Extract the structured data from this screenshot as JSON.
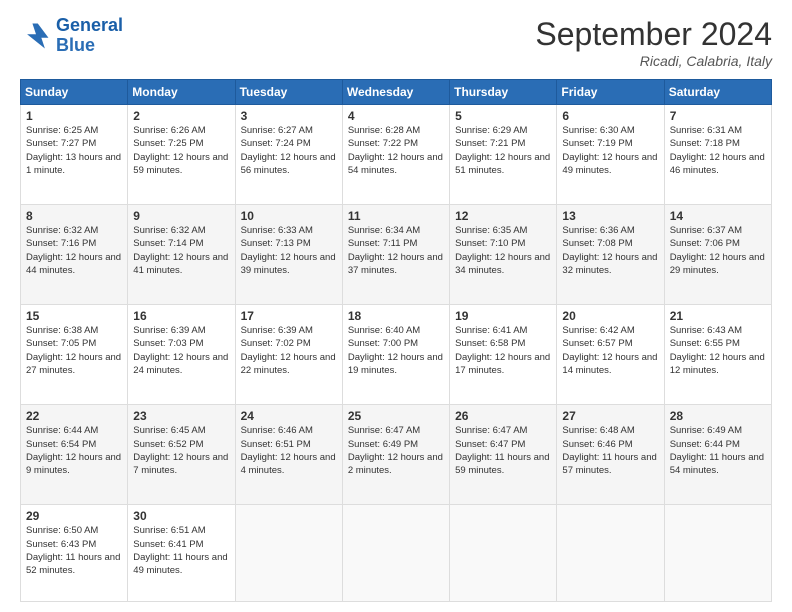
{
  "header": {
    "logo_line1": "General",
    "logo_line2": "Blue",
    "month": "September 2024",
    "location": "Ricadi, Calabria, Italy"
  },
  "days_of_week": [
    "Sunday",
    "Monday",
    "Tuesday",
    "Wednesday",
    "Thursday",
    "Friday",
    "Saturday"
  ],
  "weeks": [
    [
      {
        "day": "1",
        "sunrise": "6:25 AM",
        "sunset": "7:27 PM",
        "daylight": "Daylight: 13 hours and 1 minute."
      },
      {
        "day": "2",
        "sunrise": "6:26 AM",
        "sunset": "7:25 PM",
        "daylight": "Daylight: 12 hours and 59 minutes."
      },
      {
        "day": "3",
        "sunrise": "6:27 AM",
        "sunset": "7:24 PM",
        "daylight": "Daylight: 12 hours and 56 minutes."
      },
      {
        "day": "4",
        "sunrise": "6:28 AM",
        "sunset": "7:22 PM",
        "daylight": "Daylight: 12 hours and 54 minutes."
      },
      {
        "day": "5",
        "sunrise": "6:29 AM",
        "sunset": "7:21 PM",
        "daylight": "Daylight: 12 hours and 51 minutes."
      },
      {
        "day": "6",
        "sunrise": "6:30 AM",
        "sunset": "7:19 PM",
        "daylight": "Daylight: 12 hours and 49 minutes."
      },
      {
        "day": "7",
        "sunrise": "6:31 AM",
        "sunset": "7:18 PM",
        "daylight": "Daylight: 12 hours and 46 minutes."
      }
    ],
    [
      {
        "day": "8",
        "sunrise": "6:32 AM",
        "sunset": "7:16 PM",
        "daylight": "Daylight: 12 hours and 44 minutes."
      },
      {
        "day": "9",
        "sunrise": "6:32 AM",
        "sunset": "7:14 PM",
        "daylight": "Daylight: 12 hours and 41 minutes."
      },
      {
        "day": "10",
        "sunrise": "6:33 AM",
        "sunset": "7:13 PM",
        "daylight": "Daylight: 12 hours and 39 minutes."
      },
      {
        "day": "11",
        "sunrise": "6:34 AM",
        "sunset": "7:11 PM",
        "daylight": "Daylight: 12 hours and 37 minutes."
      },
      {
        "day": "12",
        "sunrise": "6:35 AM",
        "sunset": "7:10 PM",
        "daylight": "Daylight: 12 hours and 34 minutes."
      },
      {
        "day": "13",
        "sunrise": "6:36 AM",
        "sunset": "7:08 PM",
        "daylight": "Daylight: 12 hours and 32 minutes."
      },
      {
        "day": "14",
        "sunrise": "6:37 AM",
        "sunset": "7:06 PM",
        "daylight": "Daylight: 12 hours and 29 minutes."
      }
    ],
    [
      {
        "day": "15",
        "sunrise": "6:38 AM",
        "sunset": "7:05 PM",
        "daylight": "Daylight: 12 hours and 27 minutes."
      },
      {
        "day": "16",
        "sunrise": "6:39 AM",
        "sunset": "7:03 PM",
        "daylight": "Daylight: 12 hours and 24 minutes."
      },
      {
        "day": "17",
        "sunrise": "6:39 AM",
        "sunset": "7:02 PM",
        "daylight": "Daylight: 12 hours and 22 minutes."
      },
      {
        "day": "18",
        "sunrise": "6:40 AM",
        "sunset": "7:00 PM",
        "daylight": "Daylight: 12 hours and 19 minutes."
      },
      {
        "day": "19",
        "sunrise": "6:41 AM",
        "sunset": "6:58 PM",
        "daylight": "Daylight: 12 hours and 17 minutes."
      },
      {
        "day": "20",
        "sunrise": "6:42 AM",
        "sunset": "6:57 PM",
        "daylight": "Daylight: 12 hours and 14 minutes."
      },
      {
        "day": "21",
        "sunrise": "6:43 AM",
        "sunset": "6:55 PM",
        "daylight": "Daylight: 12 hours and 12 minutes."
      }
    ],
    [
      {
        "day": "22",
        "sunrise": "6:44 AM",
        "sunset": "6:54 PM",
        "daylight": "Daylight: 12 hours and 9 minutes."
      },
      {
        "day": "23",
        "sunrise": "6:45 AM",
        "sunset": "6:52 PM",
        "daylight": "Daylight: 12 hours and 7 minutes."
      },
      {
        "day": "24",
        "sunrise": "6:46 AM",
        "sunset": "6:51 PM",
        "daylight": "Daylight: 12 hours and 4 minutes."
      },
      {
        "day": "25",
        "sunrise": "6:47 AM",
        "sunset": "6:49 PM",
        "daylight": "Daylight: 12 hours and 2 minutes."
      },
      {
        "day": "26",
        "sunrise": "6:47 AM",
        "sunset": "6:47 PM",
        "daylight": "Daylight: 11 hours and 59 minutes."
      },
      {
        "day": "27",
        "sunrise": "6:48 AM",
        "sunset": "6:46 PM",
        "daylight": "Daylight: 11 hours and 57 minutes."
      },
      {
        "day": "28",
        "sunrise": "6:49 AM",
        "sunset": "6:44 PM",
        "daylight": "Daylight: 11 hours and 54 minutes."
      }
    ],
    [
      {
        "day": "29",
        "sunrise": "6:50 AM",
        "sunset": "6:43 PM",
        "daylight": "Daylight: 11 hours and 52 minutes."
      },
      {
        "day": "30",
        "sunrise": "6:51 AM",
        "sunset": "6:41 PM",
        "daylight": "Daylight: 11 hours and 49 minutes."
      },
      null,
      null,
      null,
      null,
      null
    ]
  ]
}
